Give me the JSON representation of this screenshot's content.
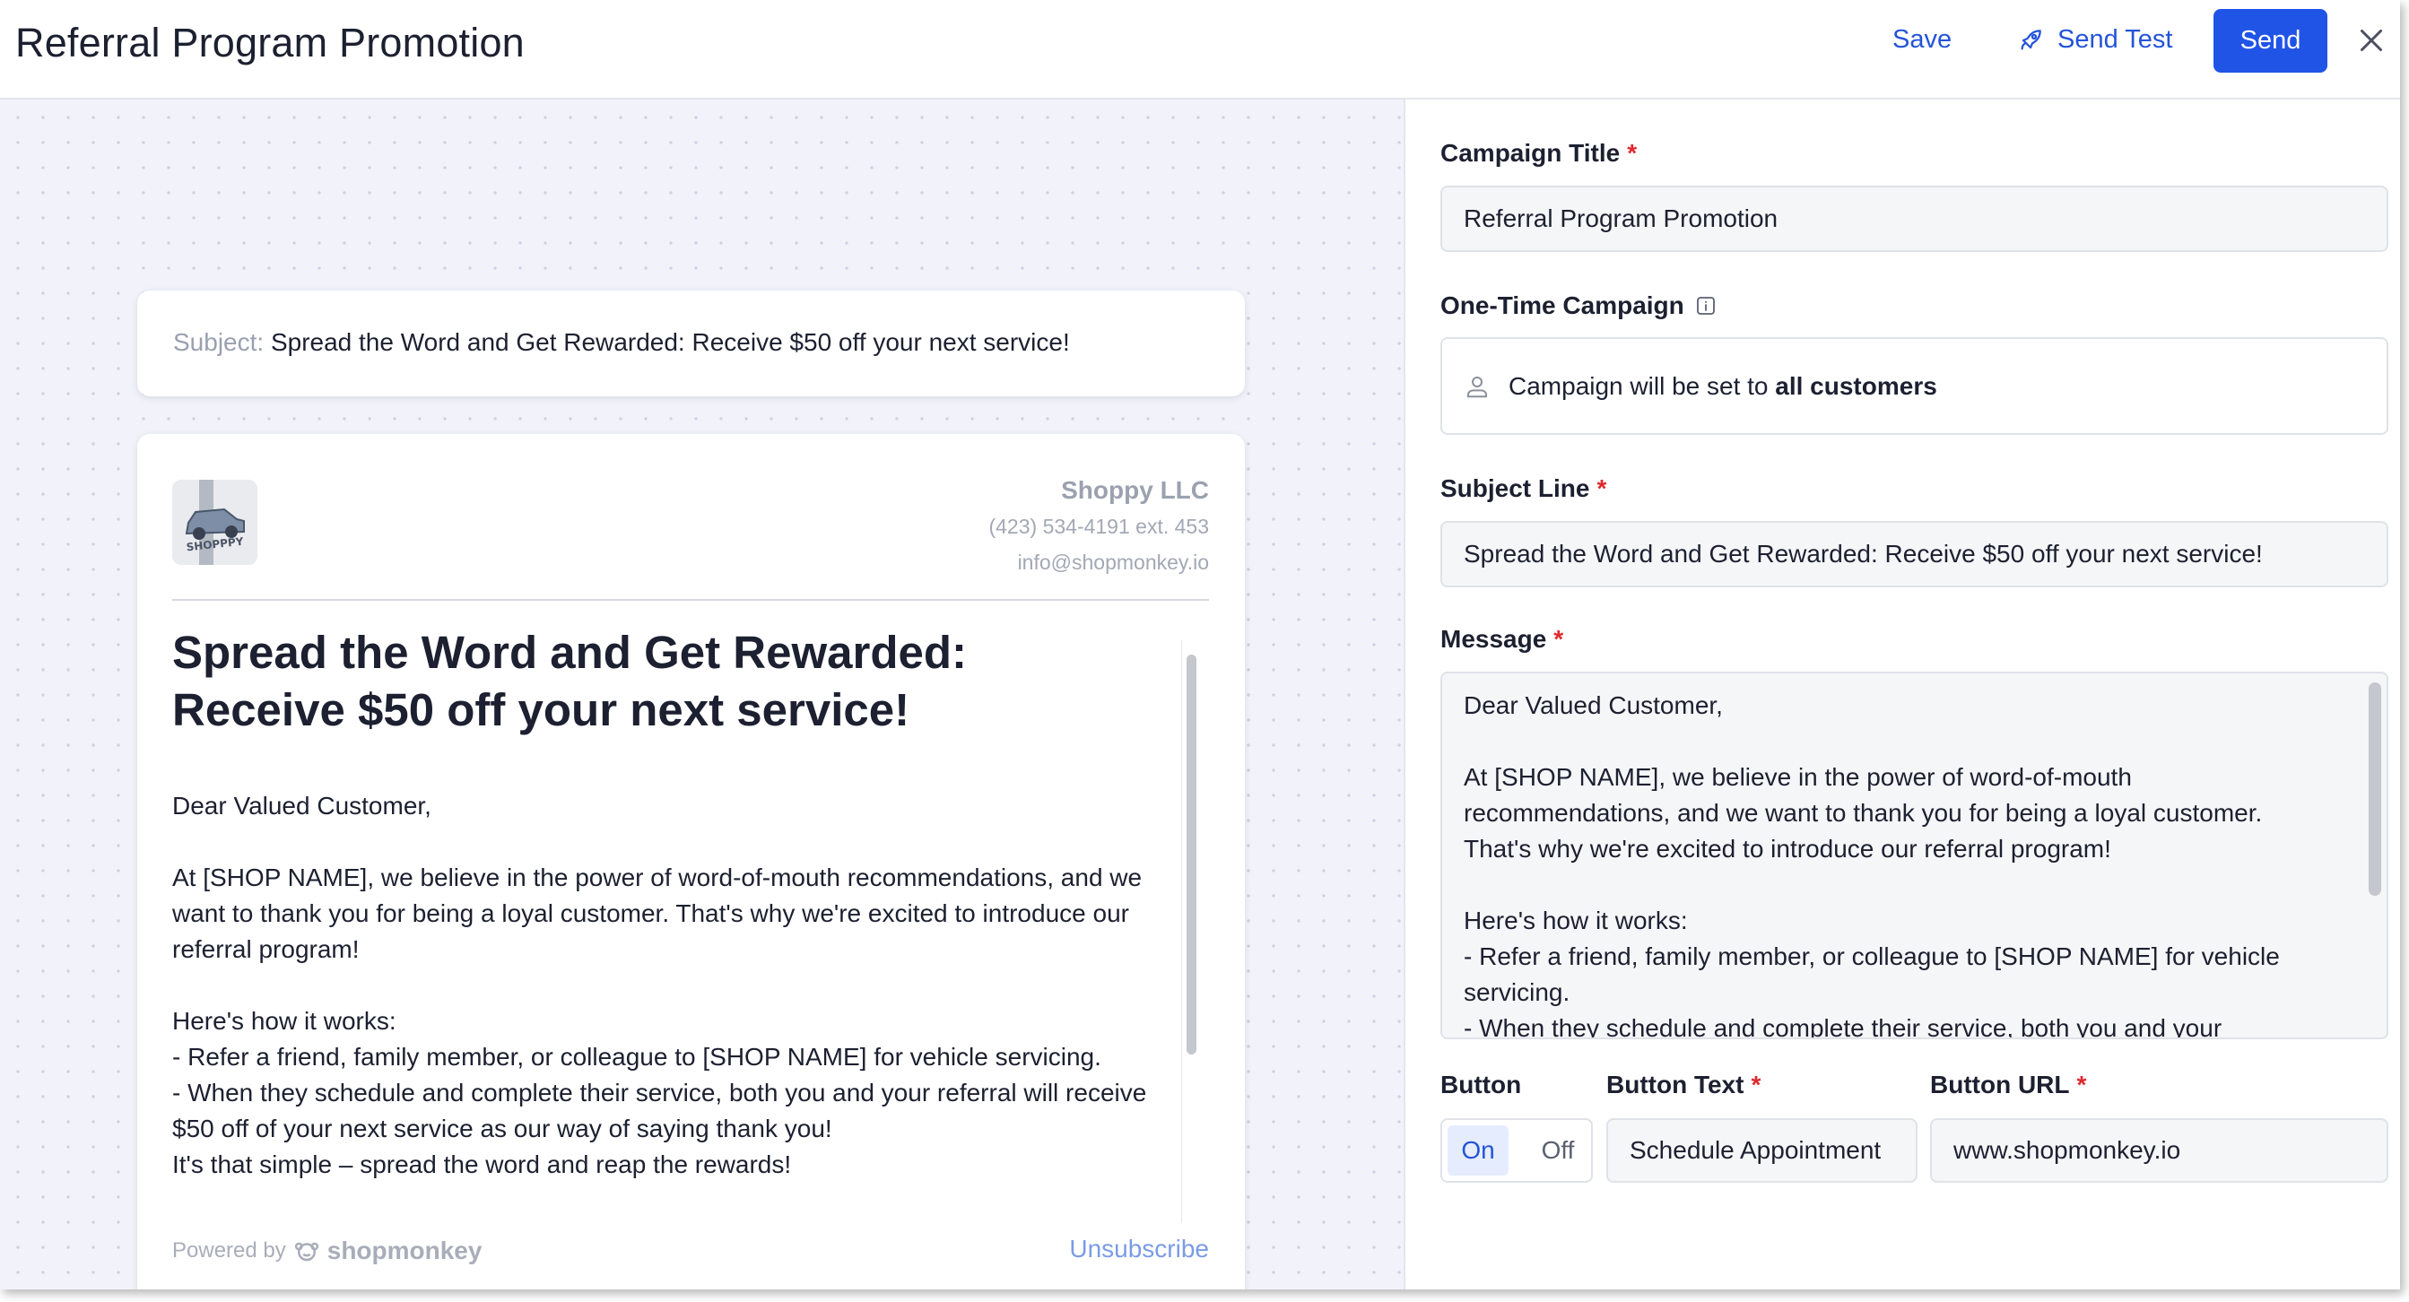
{
  "header": {
    "title": "Referral Program Promotion",
    "save_label": "Save",
    "send_test_label": "Send Test",
    "send_label": "Send"
  },
  "preview": {
    "subject_label": "Subject:",
    "subject": "Spread the Word and Get Rewarded: Receive $50 off your next service!",
    "logo_text": "SHOPPPY",
    "shop_name": "Shoppy LLC",
    "shop_phone": "(423) 534-4191 ext. 453",
    "shop_email": "info@shopmonkey.io",
    "heading": "Spread the Word and Get Rewarded: Receive $50 off your next service!",
    "message": "Dear Valued Customer,\n\nAt [SHOP NAME], we believe in the power of word-of-mouth recommendations, and we want to thank you for being a loyal customer. That's why we're excited to introduce our referral program!\n\nHere's how it works:\n- Refer a friend, family member, or colleague to [SHOP NAME] for vehicle servicing.\n- When they schedule and complete their service, both you and your referral will receive $50 off of your next service as our way of saying thank you!\nIt's that simple – spread the word and reap the rewards!",
    "powered_by": "Powered by",
    "powered_brand": "shopmonkey",
    "unsubscribe": "Unsubscribe"
  },
  "form": {
    "campaign_title_label": "Campaign Title",
    "campaign_title_value": "Referral Program Promotion",
    "one_time_label": "One-Time Campaign",
    "audience_prefix": "Campaign will be set to",
    "audience_value": "all customers",
    "subject_label": "Subject Line",
    "subject_value": "Spread the Word and Get Rewarded: Receive $50 off your next service!",
    "message_label": "Message",
    "message_value": "Dear Valued Customer,\n\nAt [SHOP NAME], we believe in the power of word-of-mouth recommendations, and we want to thank you for being a loyal customer. That's why we're excited to introduce our referral program!\n\nHere's how it works:\n- Refer a friend, family member, or colleague to [SHOP NAME] for vehicle servicing.\n- When they schedule and complete their service, both you and your referral will receive $50 off of your next service as our way of saying thank you!\nIt's that simple – spread the word and reap the rewards!",
    "button_label": "Button",
    "toggle_on": "On",
    "toggle_off": "Off",
    "button_text_label": "Button Text",
    "button_text_value": "Schedule Appointment",
    "button_url_label": "Button URL",
    "button_url_value": "www.shopmonkey.io",
    "required_mark": "*"
  },
  "colors": {
    "accent": "#1f54e6",
    "link": "#2454d8",
    "required": "#e0292e",
    "preview_bg": "#f2f3fa"
  }
}
